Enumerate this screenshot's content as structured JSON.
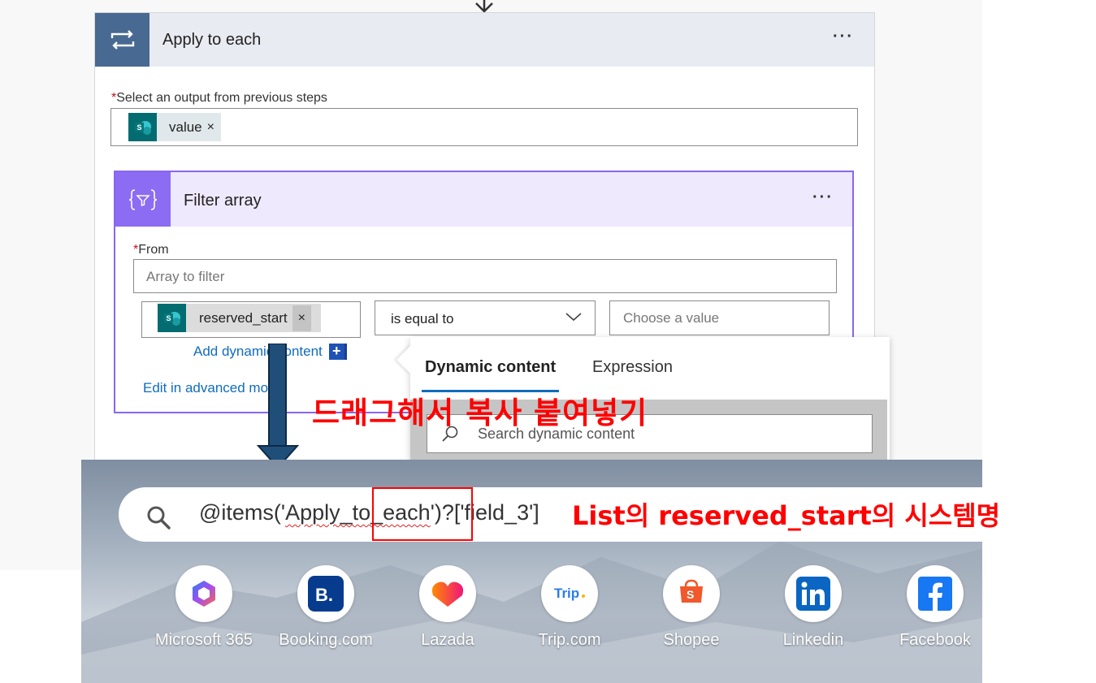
{
  "apply_to_each": {
    "title": "Apply to each",
    "more": "···",
    "field_required_mark": "*",
    "field_label": "Select an output from previous steps",
    "token_label": "value",
    "token_remove": "×"
  },
  "filter_array": {
    "title": "Filter array",
    "more": "···",
    "from_required_mark": "*",
    "from_label": "From",
    "from_placeholder": "Array to filter",
    "left_token_label": "reserved_start",
    "left_token_remove": "×",
    "operator": "is equal to",
    "right_placeholder": "Choose a value",
    "add_dynamic_label": "Add dynamic content",
    "add_dynamic_plus": "+",
    "edit_advanced_label": "Edit in advanced mode"
  },
  "dynamic_panel": {
    "tab_dynamic": "Dynamic content",
    "tab_expression": "Expression",
    "search_placeholder": "Search dynamic content"
  },
  "annotations": {
    "drag_note": "드래그해서 복사 붙여넣기",
    "list_note": "List의 reserved_start의 시스템명"
  },
  "browser": {
    "address_prefix": "@items('",
    "address_squiggle": "Apply_to_each",
    "address_mid": "')?",
    "address_highlight": "['field_3']",
    "shortcuts": [
      {
        "label": "Microsoft 365",
        "icon": "microsoft-365-icon"
      },
      {
        "label": "Booking.com",
        "icon": "booking-icon"
      },
      {
        "label": "Lazada",
        "icon": "lazada-icon"
      },
      {
        "label": "Trip.com",
        "icon": "trip-icon"
      },
      {
        "label": "Shopee",
        "icon": "shopee-icon"
      },
      {
        "label": "Linkedin",
        "icon": "linkedin-icon"
      },
      {
        "label": "Facebook",
        "icon": "facebook-icon"
      }
    ]
  },
  "colors": {
    "apply_header_icon": "#486991",
    "filter_accent": "#8c6cf3",
    "sharepoint": "#036c70",
    "link": "#0f6cbd",
    "annotation": "#ff0000"
  }
}
